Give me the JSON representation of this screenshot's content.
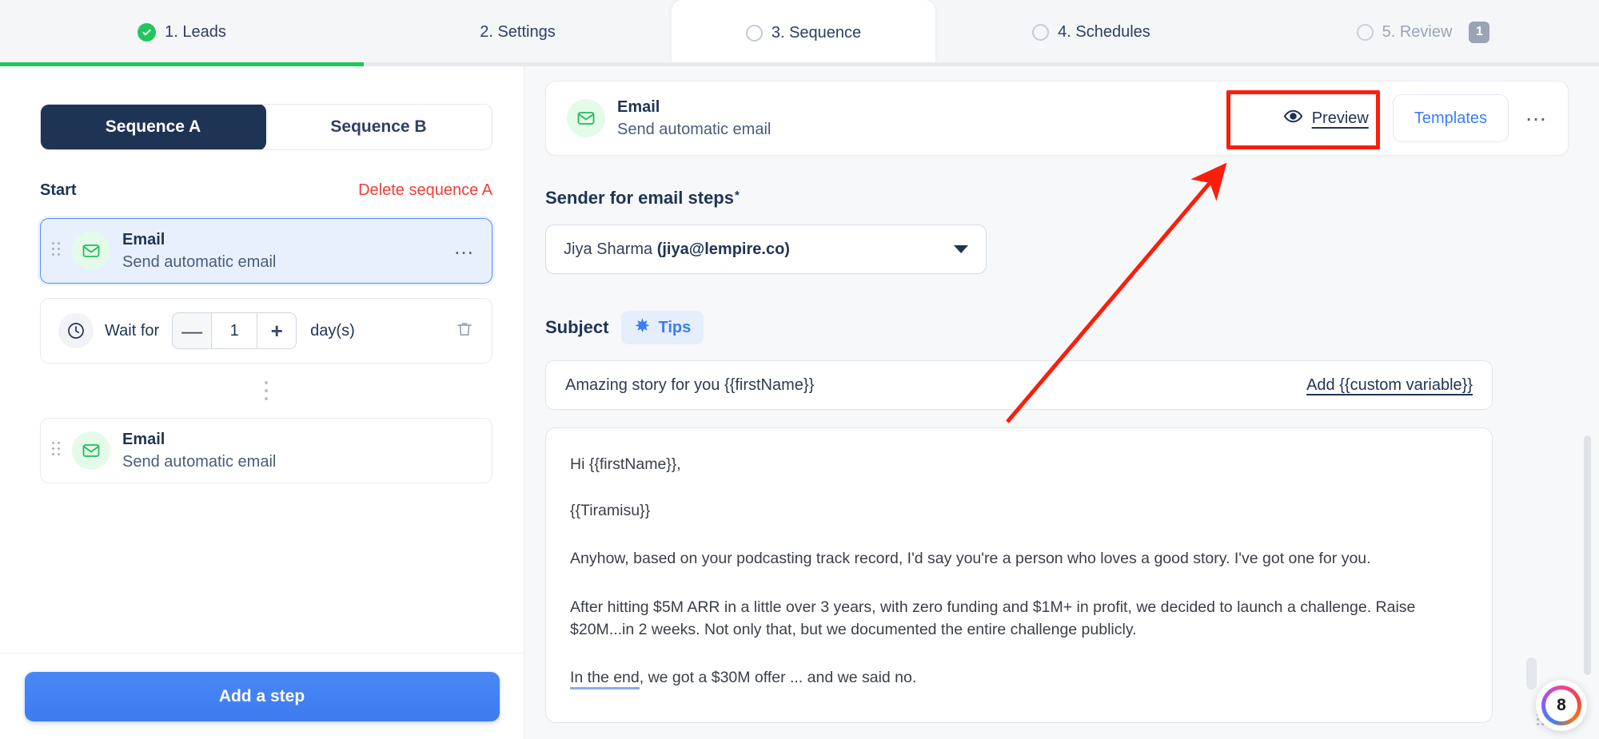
{
  "tabs": [
    {
      "label": "1. Leads",
      "state": "done",
      "badge": null,
      "icon": "check-circle-icon"
    },
    {
      "label": "2. Settings",
      "state": "done",
      "badge": null,
      "icon": null
    },
    {
      "label": "3. Sequence",
      "state": "active",
      "badge": null,
      "icon": "circle-outline-icon"
    },
    {
      "label": "4. Schedules",
      "state": "todo",
      "badge": null,
      "icon": "circle-outline-icon"
    },
    {
      "label": "5. Review",
      "state": "todo",
      "badge": "1",
      "icon": "circle-outline-icon"
    }
  ],
  "sidebar": {
    "sequence_tabs": [
      {
        "label": "Sequence A",
        "selected": true
      },
      {
        "label": "Sequence B",
        "selected": false
      }
    ],
    "start_label": "Start",
    "delete_label": "Delete sequence A",
    "steps": [
      {
        "title": "Email",
        "subtitle": "Send automatic email",
        "selected": true,
        "icon": "envelope-icon"
      },
      {
        "title": "Email",
        "subtitle": "Send automatic email",
        "selected": false,
        "icon": "envelope-icon"
      }
    ],
    "wait": {
      "label": "Wait for",
      "value": "1",
      "unit": "day(s)",
      "minus_label": "—",
      "plus_label": "+"
    },
    "add_step_label": "Add a step"
  },
  "email_header": {
    "title": "Email",
    "subtitle": "Send automatic email",
    "preview_label": "Preview",
    "templates_label": "Templates",
    "more_label": "•••"
  },
  "form": {
    "sender_label": "Sender for email steps",
    "sender_required_mark": "*",
    "sender_value_name": "Jiya Sharma ",
    "sender_value_email": "(jiya@lempire.co)",
    "subject_label": "Subject",
    "tips_label": "Tips",
    "subject_value": "Amazing story for you {{firstName}}",
    "add_variable_label": "Add {{custom variable}}",
    "body": [
      {
        "text": "Hi {{firstName}},",
        "highlight": null
      },
      {
        "text": "{{Tiramisu}}",
        "highlight": null
      },
      {
        "text": "Anyhow, based on your podcasting track record, I'd say you're a person who loves a good story. I've got one for you.",
        "highlight": null
      },
      {
        "text": "After hitting $5M ARR in a little over 3 years, with zero funding and $1M+ in profit, we decided to launch a challenge. Raise $20M...in 2 weeks. Not only that, but we documented the entire challenge publicly.",
        "highlight": null
      },
      {
        "text": "In the end, we got a $30M offer ... and we said no.",
        "highlight": "In the end"
      }
    ]
  },
  "floating_widget": {
    "count": "8"
  },
  "annotation": {
    "highlight_color": "#fc1d0b",
    "target": "Preview"
  }
}
